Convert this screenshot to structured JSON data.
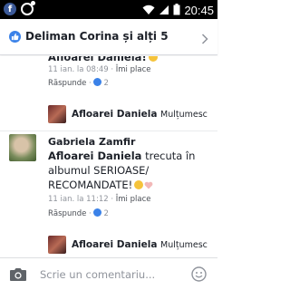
{
  "status_bar": {
    "badge_letter": "f",
    "time": "20:45"
  },
  "header": {
    "title": "Deliman Corina și alți 5"
  },
  "comments": [
    {
      "text": "Afloarei Daniela!",
      "time": "11 ian. la 08:49",
      "like_label": "Îmi place",
      "reply_label": "Răspunde",
      "like_count": "2"
    }
  ],
  "reply_preview_1": {
    "name": "Afloarei Daniela",
    "text": "Mulțumesc"
  },
  "comment_2": {
    "author": "Gabriela Zamfir",
    "mention": "Afloarei Daniela",
    "body": "trecuta în albumul SERIOASE/ RECOMANDATE!",
    "time": "11 ian. la 11:12",
    "like_label": "Îmi place",
    "reply_label": "Răspunde",
    "like_count": "2"
  },
  "reply_preview_2": {
    "name": "Afloarei Daniela",
    "text": "Mulțumesc"
  },
  "composer": {
    "placeholder": "Scrie un comentariu..."
  },
  "colors": {
    "accent": "#3b82e8",
    "text": "#1d2129",
    "meta": "#90949c"
  }
}
